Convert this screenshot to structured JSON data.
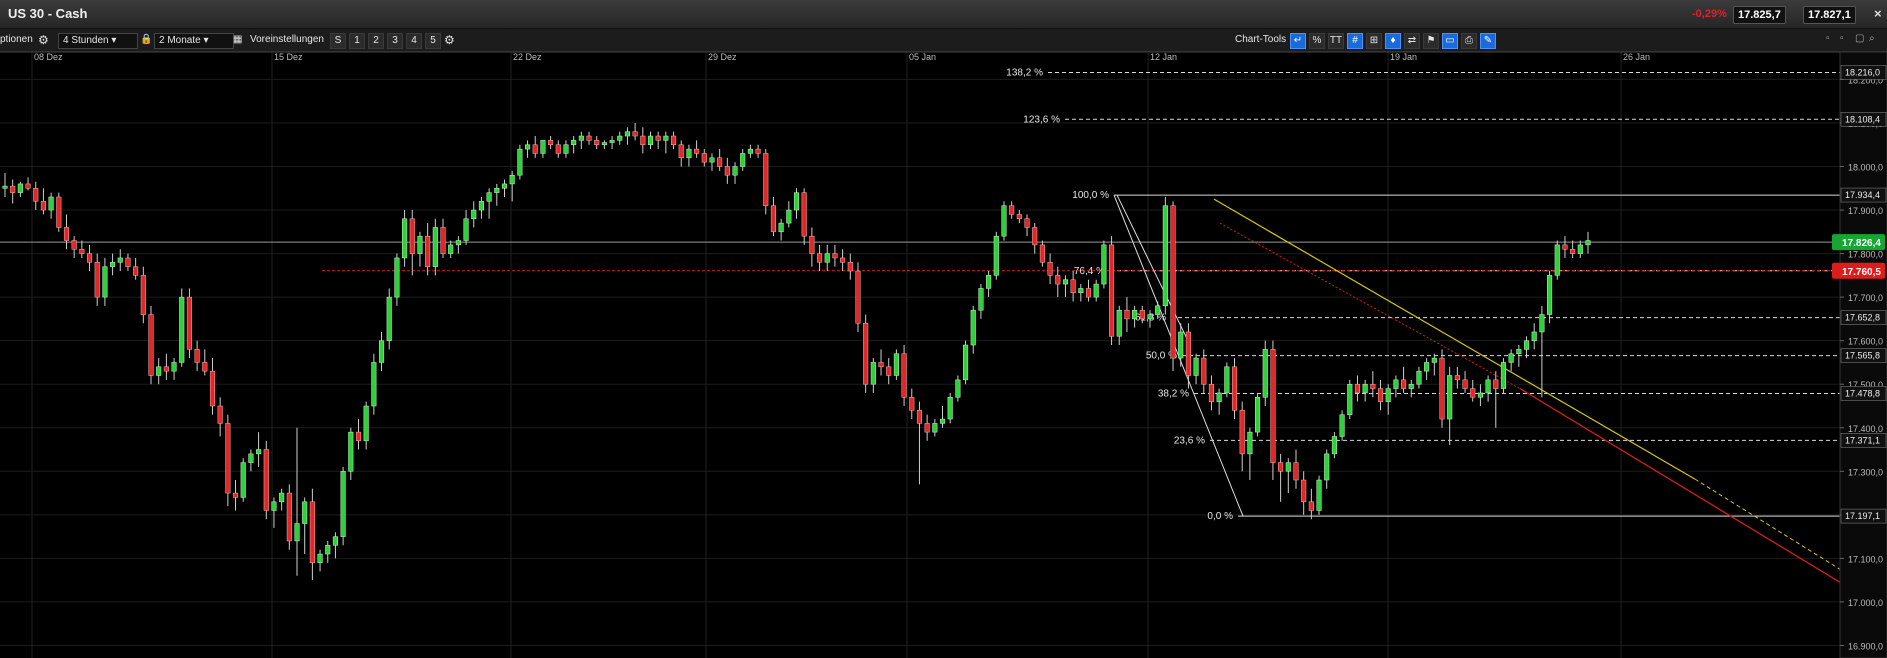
{
  "window": {
    "title": "US 30 - Cash",
    "change": "-0,29%",
    "sell": "17.825,7",
    "buy": "17.827,1",
    "close": "×"
  },
  "toolbar": {
    "functions": "ptionen",
    "interval": "4 Stunden",
    "range": "2 Monate",
    "settings": "Voreinstellungen",
    "presets": [
      "S",
      "1",
      "2",
      "3",
      "4",
      "5"
    ],
    "chart_tools": "Chart-Tools",
    "tool_percent": "%",
    "tool_text": "TT"
  },
  "chart_data": {
    "type": "candlestick",
    "x_labels": [
      "08 Dez",
      "15 Dez",
      "22 Dez",
      "29 Dez",
      "05 Jan",
      "12 Jan",
      "19 Jan",
      "26 Jan"
    ],
    "y_ticks": [
      "18.200,0",
      "18.100,0",
      "18.000,0",
      "17.900,0",
      "17.800,0",
      "17.700,0",
      "17.600,0",
      "17.500,0",
      "17.400,0",
      "17.300,0",
      "17.200,0",
      "17.100,0",
      "17.000,0",
      "16.900,0"
    ],
    "ylim": [
      16885,
      18240
    ],
    "last_price": {
      "value": 17826.4,
      "label": "17.826,4",
      "color": "#17a534"
    },
    "red_level": {
      "value": 17760.5,
      "label": "17.760,5",
      "color": "#e01b1b"
    },
    "fib_levels": [
      {
        "pct": "138,2 %",
        "value": 18216.0,
        "label": "18.216,0"
      },
      {
        "pct": "123,6 %",
        "value": 18108.4,
        "label": "18.108,4"
      },
      {
        "pct": "100,0 %",
        "value": 17934.4,
        "label": "17.934,4"
      },
      {
        "pct": "76,4 %",
        "value": 17760.5,
        "label": ""
      },
      {
        "pct": "61,8 %",
        "value": 17652.8,
        "label": "17.652,8"
      },
      {
        "pct": "50,0 %",
        "value": 17565.8,
        "label": "17.565,8"
      },
      {
        "pct": "38,2 %",
        "value": 17478.8,
        "label": "17.478,8"
      },
      {
        "pct": "23,6 %",
        "value": 17371.1,
        "label": "17.371,1"
      },
      {
        "pct": "0,0 %",
        "value": 17197.1,
        "label": "17.197,1"
      }
    ],
    "candles": [
      [
        17950,
        17985,
        17930,
        17955
      ],
      [
        17955,
        17970,
        17915,
        17940
      ],
      [
        17940,
        17965,
        17930,
        17960
      ],
      [
        17960,
        17975,
        17945,
        17950
      ],
      [
        17950,
        17965,
        17900,
        17920
      ],
      [
        17920,
        17950,
        17890,
        17900
      ],
      [
        17900,
        17940,
        17880,
        17930
      ],
      [
        17930,
        17940,
        17850,
        17860
      ],
      [
        17860,
        17890,
        17810,
        17830
      ],
      [
        17830,
        17840,
        17790,
        17810
      ],
      [
        17810,
        17830,
        17790,
        17800
      ],
      [
        17800,
        17820,
        17760,
        17780
      ],
      [
        17780,
        17800,
        17680,
        17700
      ],
      [
        17700,
        17790,
        17680,
        17770
      ],
      [
        17770,
        17800,
        17750,
        17780
      ],
      [
        17780,
        17810,
        17760,
        17790
      ],
      [
        17790,
        17800,
        17760,
        17770
      ],
      [
        17770,
        17790,
        17740,
        17750
      ],
      [
        17750,
        17770,
        17640,
        17660
      ],
      [
        17660,
        17680,
        17500,
        17520
      ],
      [
        17520,
        17560,
        17500,
        17540
      ],
      [
        17540,
        17570,
        17510,
        17530
      ],
      [
        17530,
        17560,
        17510,
        17550
      ],
      [
        17550,
        17720,
        17540,
        17700
      ],
      [
        17700,
        17720,
        17560,
        17580
      ],
      [
        17580,
        17600,
        17530,
        17550
      ],
      [
        17550,
        17580,
        17520,
        17530
      ],
      [
        17530,
        17560,
        17430,
        17450
      ],
      [
        17450,
        17470,
        17380,
        17410
      ],
      [
        17410,
        17430,
        17220,
        17250
      ],
      [
        17250,
        17280,
        17210,
        17240
      ],
      [
        17240,
        17330,
        17230,
        17320
      ],
      [
        17320,
        17350,
        17300,
        17340
      ],
      [
        17340,
        17390,
        17310,
        17350
      ],
      [
        17350,
        17370,
        17190,
        17210
      ],
      [
        17210,
        17240,
        17170,
        17230
      ],
      [
        17230,
        17260,
        17210,
        17250
      ],
      [
        17250,
        17270,
        17120,
        17140
      ],
      [
        17140,
        17400,
        17060,
        17180
      ],
      [
        17180,
        17240,
        17110,
        17230
      ],
      [
        17230,
        17260,
        17050,
        17090
      ],
      [
        17090,
        17120,
        17070,
        17110
      ],
      [
        17110,
        17140,
        17090,
        17130
      ],
      [
        17130,
        17160,
        17100,
        17150
      ],
      [
        17150,
        17310,
        17130,
        17300
      ],
      [
        17300,
        17400,
        17280,
        17390
      ],
      [
        17390,
        17420,
        17350,
        17370
      ],
      [
        17370,
        17460,
        17350,
        17450
      ],
      [
        17450,
        17570,
        17430,
        17550
      ],
      [
        17550,
        17620,
        17530,
        17600
      ],
      [
        17600,
        17720,
        17580,
        17700
      ],
      [
        17700,
        17800,
        17680,
        17790
      ],
      [
        17790,
        17900,
        17770,
        17880
      ],
      [
        17880,
        17900,
        17750,
        17800
      ],
      [
        17800,
        17850,
        17770,
        17840
      ],
      [
        17840,
        17870,
        17750,
        17770
      ],
      [
        17770,
        17880,
        17750,
        17860
      ],
      [
        17860,
        17880,
        17790,
        17800
      ],
      [
        17800,
        17830,
        17790,
        17820
      ],
      [
        17820,
        17840,
        17800,
        17830
      ],
      [
        17830,
        17900,
        17820,
        17880
      ],
      [
        17880,
        17920,
        17860,
        17900
      ],
      [
        17900,
        17930,
        17880,
        17920
      ],
      [
        17920,
        17950,
        17880,
        17940
      ],
      [
        17940,
        17960,
        17910,
        17950
      ],
      [
        17950,
        17970,
        17930,
        17960
      ],
      [
        17960,
        17990,
        17920,
        17980
      ],
      [
        17980,
        18050,
        17970,
        18040
      ],
      [
        18040,
        18060,
        18020,
        18050
      ],
      [
        18050,
        18070,
        18020,
        18030
      ],
      [
        18030,
        18060,
        18020,
        18060
      ],
      [
        18060,
        18070,
        18040,
        18050
      ],
      [
        18050,
        18060,
        18020,
        18030
      ],
      [
        18030,
        18060,
        18020,
        18050
      ],
      [
        18050,
        18070,
        18030,
        18060
      ],
      [
        18060,
        18080,
        18040,
        18070
      ],
      [
        18070,
        18080,
        18050,
        18060
      ],
      [
        18060,
        18070,
        18040,
        18050
      ],
      [
        18050,
        18060,
        18040,
        18055
      ],
      [
        18055,
        18070,
        18040,
        18060
      ],
      [
        18060,
        18080,
        18050,
        18070
      ],
      [
        18070,
        18090,
        18050,
        18080
      ],
      [
        18080,
        18100,
        18060,
        18070
      ],
      [
        18070,
        18090,
        18030,
        18050
      ],
      [
        18050,
        18080,
        18040,
        18070
      ],
      [
        18070,
        18080,
        18040,
        18060
      ],
      [
        18060,
        18080,
        18030,
        18070
      ],
      [
        18070,
        18080,
        18040,
        18050
      ],
      [
        18050,
        18060,
        18000,
        18020
      ],
      [
        18020,
        18050,
        18000,
        18040
      ],
      [
        18040,
        18060,
        18020,
        18030
      ],
      [
        18030,
        18040,
        18000,
        18010
      ],
      [
        18010,
        18030,
        17990,
        18020
      ],
      [
        18020,
        18040,
        17990,
        18000
      ],
      [
        18000,
        18020,
        17960,
        17980
      ],
      [
        17980,
        18010,
        17960,
        18000
      ],
      [
        18000,
        18040,
        17990,
        18030
      ],
      [
        18030,
        18050,
        18020,
        18040
      ],
      [
        18040,
        18050,
        18020,
        18030
      ],
      [
        18030,
        18040,
        17890,
        17910
      ],
      [
        17910,
        17930,
        17840,
        17850
      ],
      [
        17850,
        17880,
        17830,
        17870
      ],
      [
        17870,
        17920,
        17860,
        17900
      ],
      [
        17900,
        17950,
        17880,
        17940
      ],
      [
        17940,
        17950,
        17820,
        17840
      ],
      [
        17840,
        17860,
        17770,
        17800
      ],
      [
        17800,
        17820,
        17760,
        17780
      ],
      [
        17780,
        17820,
        17760,
        17800
      ],
      [
        17800,
        17820,
        17770,
        17790
      ],
      [
        17790,
        17810,
        17760,
        17780
      ],
      [
        17780,
        17800,
        17740,
        17760
      ],
      [
        17760,
        17780,
        17620,
        17640
      ],
      [
        17640,
        17660,
        17480,
        17500
      ],
      [
        17500,
        17560,
        17480,
        17550
      ],
      [
        17550,
        17580,
        17520,
        17540
      ],
      [
        17540,
        17560,
        17500,
        17520
      ],
      [
        17520,
        17580,
        17510,
        17570
      ],
      [
        17570,
        17590,
        17450,
        17470
      ],
      [
        17470,
        17490,
        17420,
        17440
      ],
      [
        17440,
        17460,
        17270,
        17410
      ],
      [
        17410,
        17430,
        17370,
        17390
      ],
      [
        17390,
        17420,
        17380,
        17410
      ],
      [
        17410,
        17450,
        17400,
        17420
      ],
      [
        17420,
        17480,
        17410,
        17470
      ],
      [
        17470,
        17520,
        17460,
        17510
      ],
      [
        17510,
        17600,
        17500,
        17590
      ],
      [
        17590,
        17680,
        17570,
        17670
      ],
      [
        17670,
        17730,
        17650,
        17720
      ],
      [
        17720,
        17760,
        17700,
        17750
      ],
      [
        17750,
        17850,
        17740,
        17840
      ],
      [
        17840,
        17920,
        17830,
        17910
      ],
      [
        17910,
        17920,
        17880,
        17890
      ],
      [
        17890,
        17900,
        17870,
        17880
      ],
      [
        17880,
        17890,
        17840,
        17860
      ],
      [
        17860,
        17870,
        17800,
        17820
      ],
      [
        17820,
        17830,
        17770,
        17780
      ],
      [
        17780,
        17800,
        17730,
        17750
      ],
      [
        17750,
        17770,
        17700,
        17730
      ],
      [
        17730,
        17750,
        17700,
        17740
      ],
      [
        17740,
        17760,
        17690,
        17710
      ],
      [
        17710,
        17730,
        17690,
        17720
      ],
      [
        17720,
        17740,
        17690,
        17700
      ],
      [
        17700,
        17740,
        17690,
        17730
      ],
      [
        17730,
        17830,
        17720,
        17820
      ],
      [
        17820,
        17840,
        17590,
        17610
      ],
      [
        17610,
        17680,
        17590,
        17670
      ],
      [
        17670,
        17700,
        17620,
        17650
      ],
      [
        17650,
        17680,
        17630,
        17670
      ],
      [
        17670,
        17680,
        17640,
        17650
      ],
      [
        17650,
        17670,
        17630,
        17660
      ],
      [
        17660,
        17690,
        17650,
        17680
      ],
      [
        17680,
        17930,
        17660,
        17910
      ],
      [
        17910,
        17920,
        17530,
        17560
      ],
      [
        17560,
        17640,
        17540,
        17620
      ],
      [
        17620,
        17640,
        17490,
        17520
      ],
      [
        17520,
        17570,
        17500,
        17560
      ],
      [
        17560,
        17580,
        17480,
        17500
      ],
      [
        17500,
        17520,
        17440,
        17460
      ],
      [
        17460,
        17490,
        17430,
        17480
      ],
      [
        17480,
        17550,
        17470,
        17540
      ],
      [
        17540,
        17560,
        17420,
        17440
      ],
      [
        17440,
        17460,
        17300,
        17340
      ],
      [
        17340,
        17400,
        17280,
        17390
      ],
      [
        17390,
        17480,
        17380,
        17470
      ],
      [
        17470,
        17600,
        17450,
        17580
      ],
      [
        17580,
        17600,
        17280,
        17320
      ],
      [
        17320,
        17340,
        17230,
        17300
      ],
      [
        17300,
        17330,
        17250,
        17320
      ],
      [
        17320,
        17350,
        17260,
        17280
      ],
      [
        17280,
        17300,
        17200,
        17230
      ],
      [
        17230,
        17260,
        17190,
        17210
      ],
      [
        17210,
        17290,
        17200,
        17280
      ],
      [
        17280,
        17350,
        17260,
        17340
      ],
      [
        17340,
        17390,
        17330,
        17380
      ],
      [
        17380,
        17440,
        17370,
        17430
      ],
      [
        17430,
        17510,
        17420,
        17500
      ],
      [
        17500,
        17520,
        17460,
        17480
      ],
      [
        17480,
        17510,
        17460,
        17500
      ],
      [
        17500,
        17530,
        17470,
        17490
      ],
      [
        17490,
        17510,
        17440,
        17460
      ],
      [
        17460,
        17500,
        17430,
        17490
      ],
      [
        17490,
        17520,
        17470,
        17510
      ],
      [
        17510,
        17540,
        17480,
        17490
      ],
      [
        17490,
        17510,
        17470,
        17500
      ],
      [
        17500,
        17540,
        17490,
        17530
      ],
      [
        17530,
        17560,
        17510,
        17550
      ],
      [
        17550,
        17570,
        17520,
        17560
      ],
      [
        17560,
        17580,
        17400,
        17420
      ],
      [
        17420,
        17540,
        17360,
        17520
      ],
      [
        17520,
        17540,
        17490,
        17510
      ],
      [
        17510,
        17530,
        17480,
        17490
      ],
      [
        17490,
        17510,
        17460,
        17470
      ],
      [
        17470,
        17500,
        17450,
        17480
      ],
      [
        17480,
        17520,
        17460,
        17510
      ],
      [
        17510,
        17530,
        17400,
        17490
      ],
      [
        17490,
        17560,
        17480,
        17550
      ],
      [
        17550,
        17580,
        17530,
        17570
      ],
      [
        17570,
        17590,
        17540,
        17580
      ],
      [
        17580,
        17610,
        17560,
        17600
      ],
      [
        17600,
        17640,
        17580,
        17620
      ],
      [
        17620,
        17680,
        17470,
        17660
      ],
      [
        17660,
        17760,
        17640,
        17750
      ],
      [
        17750,
        17830,
        17740,
        17820
      ],
      [
        17820,
        17840,
        17790,
        17810
      ],
      [
        17810,
        17830,
        17790,
        17800
      ],
      [
        17800,
        17830,
        17790,
        17820
      ],
      [
        17820,
        17850,
        17800,
        17830
      ]
    ],
    "annotations": {
      "fib_base_low": 17197.1,
      "fib_high": 17934.4,
      "trendline_color": "#d4c51a",
      "trendline2_color": "#d21f1f"
    }
  }
}
